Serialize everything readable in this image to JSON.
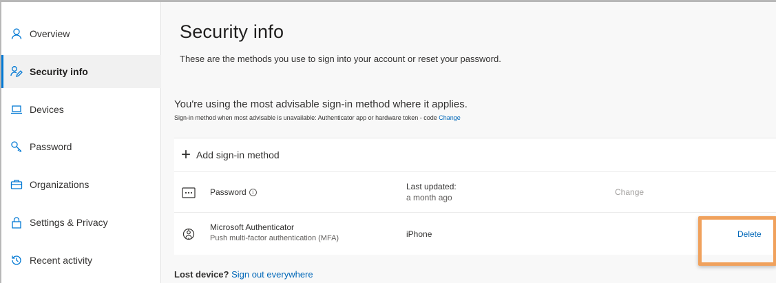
{
  "sidebar": {
    "items": [
      {
        "label": "Overview",
        "icon": "person-icon",
        "active": false
      },
      {
        "label": "Security info",
        "icon": "security-info-icon",
        "active": true
      },
      {
        "label": "Devices",
        "icon": "laptop-icon",
        "active": false
      },
      {
        "label": "Password",
        "icon": "key-icon",
        "active": false
      },
      {
        "label": "Organizations",
        "icon": "briefcase-icon",
        "active": false
      },
      {
        "label": "Settings & Privacy",
        "icon": "lock-icon",
        "active": false
      },
      {
        "label": "Recent activity",
        "icon": "history-icon",
        "active": false
      }
    ]
  },
  "main": {
    "title": "Security info",
    "subtitle": "These are the methods you use to sign into your account or reset your password.",
    "advisable": {
      "title": "You're using the most advisable sign-in method where it applies.",
      "subtitle": "Sign-in method when most advisable is unavailable: Authenticator app or hardware token - code",
      "change_link": "Change"
    },
    "add_method_label": "Add sign-in method",
    "methods": [
      {
        "name": "Password",
        "icon": "password-dots-icon",
        "detail_label": "Last updated:",
        "detail_value": "a month ago",
        "action": "Change"
      },
      {
        "name": "Microsoft Authenticator",
        "description": "Push multi-factor authentication (MFA)",
        "icon": "authenticator-icon",
        "detail_value": "iPhone",
        "action": "Delete"
      }
    ],
    "lost_device": {
      "label": "Lost device?",
      "link": "Sign out everywhere"
    }
  },
  "colors": {
    "accent": "#0078d4",
    "link": "#0067b8",
    "highlight": "#f0a15c"
  }
}
